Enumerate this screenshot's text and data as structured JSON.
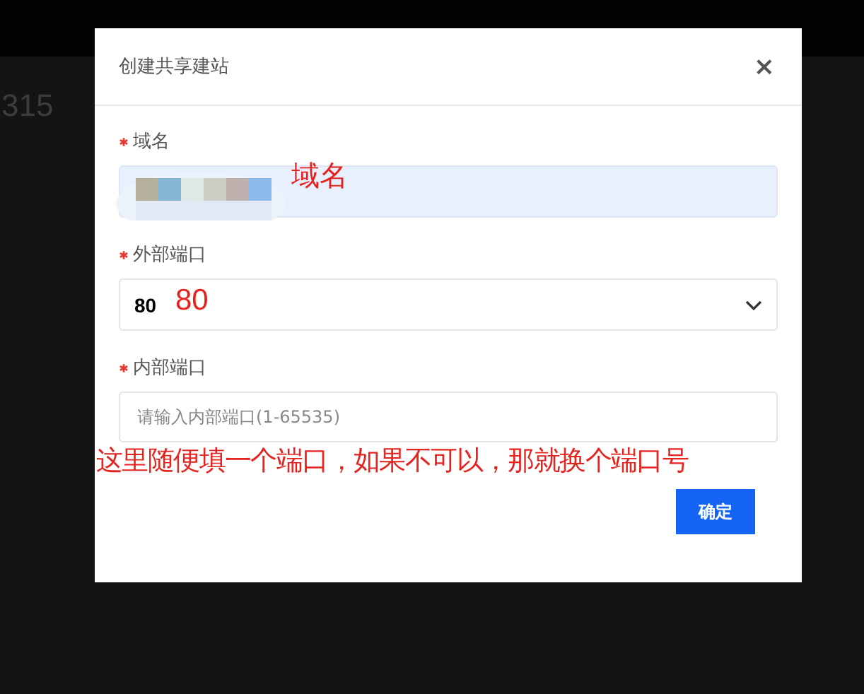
{
  "page": {
    "heading": "315"
  },
  "dialog": {
    "title": "创建共享建站",
    "close": "×",
    "fields": [
      {
        "kind": "blurred",
        "label": "域名",
        "required": true,
        "note": "域名"
      },
      {
        "kind": "select",
        "label": "外部端口",
        "required": true,
        "value": "80",
        "note": "80"
      },
      {
        "kind": "input",
        "label": "内部端口",
        "required": true,
        "placeholder": "请输入内部端口(1-65535)",
        "note": "这里随便填一个端口，如果不可以，那就换个端口号"
      }
    ],
    "confirm": "确定"
  }
}
